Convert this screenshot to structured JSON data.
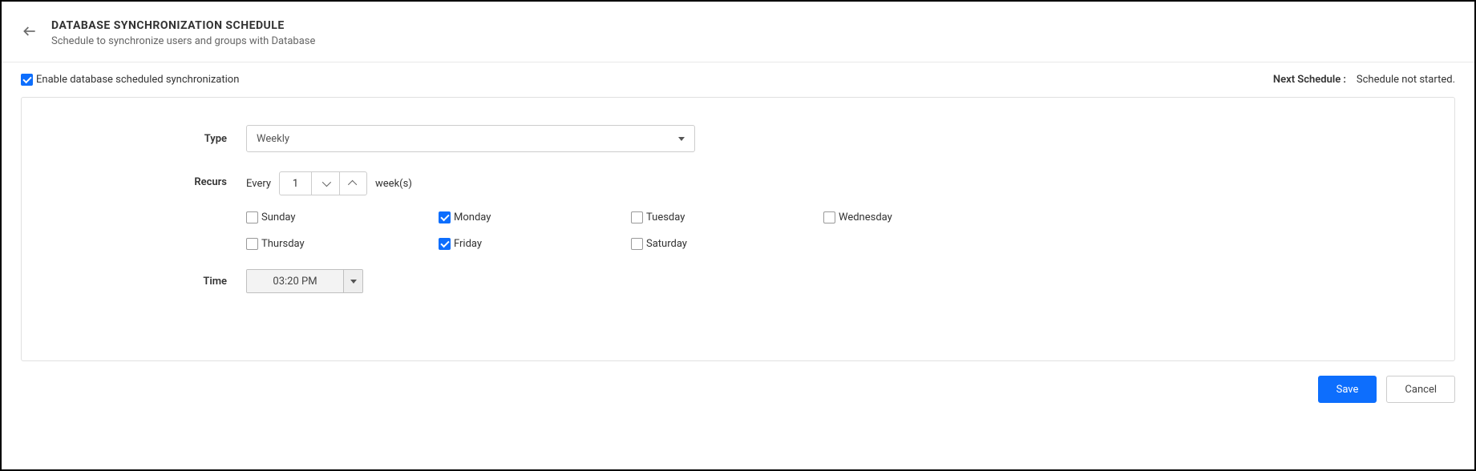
{
  "header": {
    "title": "DATABASE SYNCHRONIZATION SCHEDULE",
    "subtitle": "Schedule to synchronize users and groups with Database"
  },
  "enable": {
    "checked": true,
    "label": "Enable database scheduled synchronization"
  },
  "next_schedule": {
    "label": "Next Schedule :",
    "value": "Schedule not started."
  },
  "form": {
    "type_label": "Type",
    "type_value": "Weekly",
    "recurs_label": "Recurs",
    "recurs_prefix": "Every",
    "recurs_value": "1",
    "recurs_suffix": "week(s)",
    "time_label": "Time",
    "time_value": "03:20 PM"
  },
  "days": [
    {
      "label": "Sunday",
      "checked": false
    },
    {
      "label": "Monday",
      "checked": true
    },
    {
      "label": "Tuesday",
      "checked": false
    },
    {
      "label": "Wednesday",
      "checked": false
    },
    {
      "label": "Thursday",
      "checked": false
    },
    {
      "label": "Friday",
      "checked": true
    },
    {
      "label": "Saturday",
      "checked": false
    }
  ],
  "footer": {
    "save": "Save",
    "cancel": "Cancel"
  }
}
